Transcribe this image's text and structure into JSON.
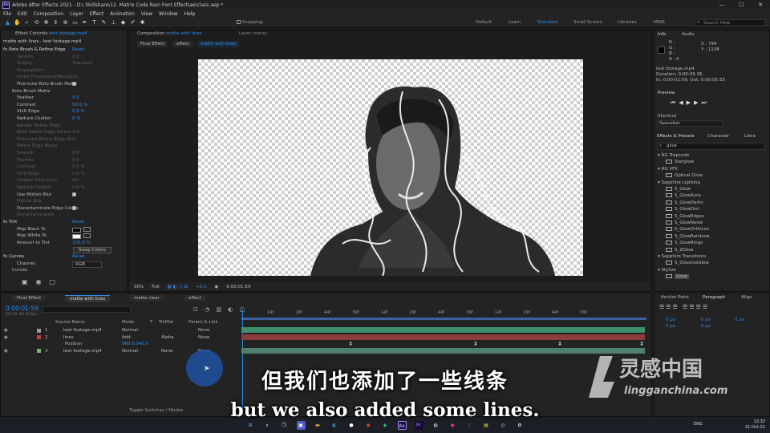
{
  "titlebar": {
    "title": "Adobe After Effects 2021 - D:\\ Skillshare\\12. Matrix Code Rain Font Effect\\ae\\class.aep *",
    "app_icon": "Ae"
  },
  "menu": [
    "File",
    "Edit",
    "Composition",
    "Layer",
    "Effect",
    "Animation",
    "View",
    "Window",
    "Help"
  ],
  "toolbar": {
    "snapping": "Snapping",
    "workspaces": [
      "Default",
      "Learn",
      "Standard",
      "Small Screen",
      "Libraries",
      "MINE"
    ],
    "active_workspace": "Standard",
    "search_placeholder": "Search Help"
  },
  "effect_controls": {
    "tab": "Effect Controls",
    "tab_layer": "test footage.mp4",
    "header": "matte with lines - test footage.mp4",
    "rows": [
      {
        "t": "fx  Roto Brush & Refine Edge",
        "r": "Reset",
        "kind": "fx"
      },
      {
        "t": "Version",
        "v": "2.0",
        "kind": "dim"
      },
      {
        "t": "Quality",
        "v": "Standard",
        "kind": "dim"
      },
      {
        "t": "Propagation",
        "kind": "dim"
      },
      {
        "t": "Invert Foreground/Backgrou",
        "kind": "dim"
      },
      {
        "t": "Fine-tune Roto Brush Matte",
        "kind": "check"
      },
      {
        "t": "Roto Brush Matte",
        "kind": "group"
      },
      {
        "t": "Feather",
        "v": "5.0",
        "kind": "val"
      },
      {
        "t": "Contrast",
        "v": "50.0 %",
        "kind": "val"
      },
      {
        "t": "Shift Edge",
        "v": "0.0 %",
        "kind": "val"
      },
      {
        "t": "Reduce Chatter",
        "v": "0 %",
        "kind": "val"
      },
      {
        "t": "Render Refine Edge",
        "kind": "dim"
      },
      {
        "t": "Base Refine Edge Radius",
        "v": "3.0",
        "kind": "dim"
      },
      {
        "t": "Fine-tune Refine Edge Matt",
        "kind": "dim"
      },
      {
        "t": "Refine Edge Matte",
        "kind": "dim"
      },
      {
        "t": "Smooth",
        "v": "0.0",
        "kind": "dim"
      },
      {
        "t": "Feather",
        "v": "0.0",
        "kind": "dim"
      },
      {
        "t": "Contrast",
        "v": "0.0 %",
        "kind": "dim"
      },
      {
        "t": "Shift Edge",
        "v": "0.0 %",
        "kind": "dim"
      },
      {
        "t": "Chatter Reduction",
        "v": "On",
        "kind": "dim"
      },
      {
        "t": "Reduce Chatter",
        "v": "0.0 %",
        "kind": "dim"
      },
      {
        "t": "Use Motion Blur",
        "kind": "check"
      },
      {
        "t": "Motion Blur",
        "kind": "dim"
      },
      {
        "t": "Decontaminate Edge Colors",
        "kind": "check"
      },
      {
        "t": "Decontamination",
        "kind": "dim"
      },
      {
        "t": "fx  Tint",
        "r": "Reset",
        "kind": "fx"
      },
      {
        "t": "Map Black To",
        "kind": "swatch-black"
      },
      {
        "t": "Map White To",
        "kind": "swatch-white"
      },
      {
        "t": "Amount to Tint",
        "v": "100.0 %",
        "kind": "val"
      },
      {
        "t": "",
        "v": "Swap Colors",
        "kind": "button"
      },
      {
        "t": "fx  Curves",
        "r": "Reset",
        "kind": "fx"
      },
      {
        "t": "Channel:",
        "v": "RGB",
        "kind": "select"
      },
      {
        "t": "Curves",
        "kind": "group"
      }
    ]
  },
  "composition": {
    "tab": "Composition",
    "tab_comp": "matte with lines",
    "layer_tab": "Layer (none)",
    "crumbs": [
      "Final Effect",
      "effect",
      "matte with lines"
    ],
    "zoom": "50%",
    "resolution": "Full",
    "exposure": "+0.0",
    "timecode": "0:00:01:59"
  },
  "info": {
    "tab": "Info",
    "tab2": "Audio",
    "r": "R :",
    "g": "G :",
    "b": "B :",
    "a": "A : 0",
    "x": "X : 794",
    "y": "Y : 1108",
    "file": "test footage.mp4",
    "duration": "Duration: 0:00:05:36",
    "inout": "In: 0:00:01:59, Out: 0:00:05:33"
  },
  "preview": {
    "tab": "Preview",
    "shortcut_label": "Shortcut",
    "shortcut": "Spacebar"
  },
  "effects_presets": {
    "tab": "Effects & Presets",
    "tab2": "Character",
    "tab3": "Libra",
    "search": "glow",
    "items": [
      {
        "t": "RG Trapcode",
        "g": true
      },
      {
        "t": "Starglow"
      },
      {
        "t": "RG VFX",
        "g": true
      },
      {
        "t": "Optical Glow"
      },
      {
        "t": "Sapphire Lighting",
        "g": true
      },
      {
        "t": "S_Glow"
      },
      {
        "t": "S_GlowAura"
      },
      {
        "t": "S_GlowDarks"
      },
      {
        "t": "S_GlowDist"
      },
      {
        "t": "S_GlowEdges"
      },
      {
        "t": "S_GlowNoise"
      },
      {
        "t": "S_GlowOrthicon"
      },
      {
        "t": "S_GlowRainbow"
      },
      {
        "t": "S_GlowRings"
      },
      {
        "t": "S_ZGlow"
      },
      {
        "t": "Sapphire Transitions",
        "g": true
      },
      {
        "t": "S_DissolveGlow"
      },
      {
        "t": "Stylize",
        "g": true
      },
      {
        "t": "Glow",
        "sel": true
      }
    ]
  },
  "paragraph": {
    "tab1": "Anchor Point",
    "tab2": "Paragraph",
    "tab3": "Align",
    "px": [
      "0 px",
      "0 px",
      "0 px",
      "0 px",
      "0 px"
    ]
  },
  "timeline": {
    "tabs": [
      "Final Effect",
      "matte with lines",
      "matte clear",
      "effect"
    ],
    "active": "matte with lines",
    "timecode": "0:00:01:59",
    "frames": "00119 (60.00 fps)",
    "headers": [
      "Source Name",
      "Mode",
      "T",
      "TrkMat",
      "Parent & Link"
    ],
    "ruler": [
      "14f",
      "29f",
      "44f",
      "59f",
      "14f",
      "29f",
      "44f",
      "59f",
      "14f",
      "29f",
      "44f",
      "59f"
    ],
    "layers": [
      {
        "n": "1",
        "name": "test footage.mp4",
        "mode": "Normal",
        "trk": "",
        "parent": "None",
        "color": "#9a9a9a",
        "track": "#3e8f6c"
      },
      {
        "n": "2",
        "name": "lines",
        "mode": "Add",
        "trk": "Alpha",
        "parent": "None",
        "color": "#c43c3c",
        "track": "#8f3b3b"
      },
      {
        "n": "",
        "name": "Position",
        "mode": "960.0,540.0",
        "trk": "",
        "parent": "",
        "color": "",
        "track": ""
      },
      {
        "n": "3",
        "name": "test footage.mp4",
        "mode": "Normal",
        "trk": "None",
        "parent": "None",
        "color": "#6fb56f",
        "track": "#4f7f6f"
      }
    ],
    "toggle": "Toggle Switches / Modes"
  },
  "subtitles": {
    "cn": "但我们也添加了一些线条",
    "en": "but we also added some lines."
  },
  "watermark": {
    "cn": "灵感中国",
    "en": "lingganchina.com"
  },
  "taskbar": {
    "lang": "ENG",
    "time": "13:32",
    "date": "21-Oct-21"
  }
}
